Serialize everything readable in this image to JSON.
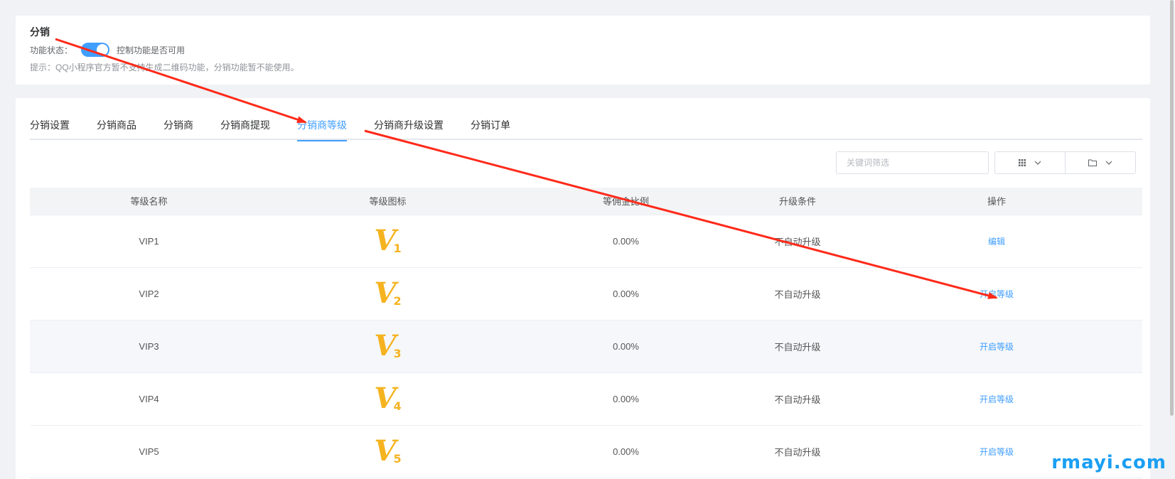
{
  "feature": {
    "title": "分销",
    "status_label": "功能状态：",
    "toggle_on": true,
    "toggle_hint": "控制功能是否可用",
    "tip": "提示：QQ小程序官方暂不支持生成二维码功能，分销功能暂不能使用。"
  },
  "tabs": [
    {
      "label": "分销设置",
      "active": false
    },
    {
      "label": "分销商品",
      "active": false
    },
    {
      "label": "分销商",
      "active": false
    },
    {
      "label": "分销商提现",
      "active": false
    },
    {
      "label": "分销商等级",
      "active": true
    },
    {
      "label": "分销商升级设置",
      "active": false
    },
    {
      "label": "分销订单",
      "active": false
    }
  ],
  "toolbar": {
    "search_placeholder": "关键词筛选",
    "columns_icon": "grid-icon",
    "export_icon": "folder-icon"
  },
  "table": {
    "headers": [
      "等级名称",
      "等级图标",
      "等佣金比例",
      "升级条件",
      "操作"
    ],
    "rows": [
      {
        "name": "VIP1",
        "icon_num": "1",
        "ratio": "0.00%",
        "condition": "不自动升级",
        "action": "编辑"
      },
      {
        "name": "VIP2",
        "icon_num": "2",
        "ratio": "0.00%",
        "condition": "不自动升级",
        "action": "开启等级"
      },
      {
        "name": "VIP3",
        "icon_num": "3",
        "ratio": "0.00%",
        "condition": "不自动升级",
        "action": "开启等级"
      },
      {
        "name": "VIP4",
        "icon_num": "4",
        "ratio": "0.00%",
        "condition": "不自动升级",
        "action": "开启等级"
      },
      {
        "name": "VIP5",
        "icon_num": "5",
        "ratio": "0.00%",
        "condition": "不自动升级",
        "action": "开启等级"
      }
    ]
  },
  "watermark": "rmayi.com",
  "colors": {
    "accent": "#409eff",
    "annotation": "#ff2a1a",
    "icon": "#f5b320",
    "watermark": "#1a9ff2"
  }
}
